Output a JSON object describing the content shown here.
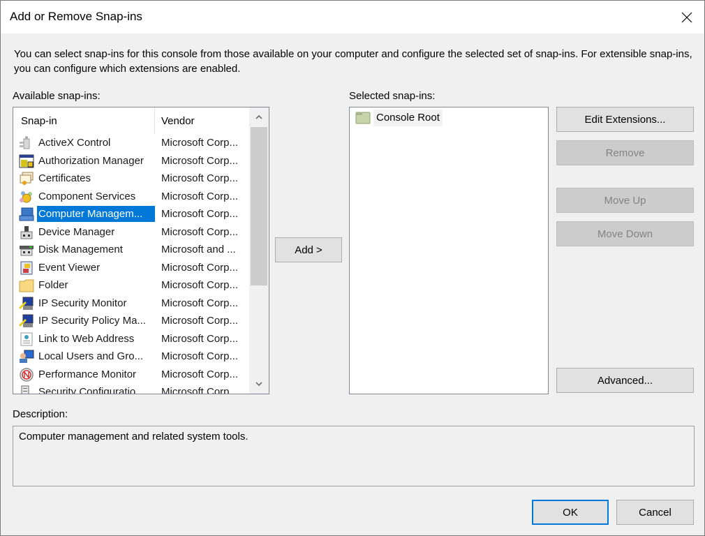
{
  "window": {
    "title": "Add or Remove Snap-ins",
    "close_icon": "close-icon"
  },
  "intro_text": "You can select snap-ins for this console from those available on your computer and configure the selected set of snap-ins. For extensible snap-ins, you can configure which extensions are enabled.",
  "available": {
    "label": "Available snap-ins:",
    "columns": [
      "Snap-in",
      "Vendor"
    ],
    "rows": [
      {
        "name": "ActiveX Control",
        "vendor": "Microsoft Corp...",
        "icon": "activex-icon"
      },
      {
        "name": "Authorization Manager",
        "vendor": "Microsoft Corp...",
        "icon": "authorization-manager-icon"
      },
      {
        "name": "Certificates",
        "vendor": "Microsoft Corp...",
        "icon": "certificates-icon"
      },
      {
        "name": "Component Services",
        "vendor": "Microsoft Corp...",
        "icon": "component-services-icon"
      },
      {
        "name": "Computer Managem...",
        "vendor": "Microsoft Corp...",
        "icon": "computer-management-icon",
        "selected": true
      },
      {
        "name": "Device Manager",
        "vendor": "Microsoft Corp...",
        "icon": "device-manager-icon"
      },
      {
        "name": "Disk Management",
        "vendor": "Microsoft and ...",
        "icon": "disk-management-icon"
      },
      {
        "name": "Event Viewer",
        "vendor": "Microsoft Corp...",
        "icon": "event-viewer-icon"
      },
      {
        "name": "Folder",
        "vendor": "Microsoft Corp...",
        "icon": "folder-icon"
      },
      {
        "name": "IP Security Monitor",
        "vendor": "Microsoft Corp...",
        "icon": "ip-security-monitor-icon"
      },
      {
        "name": "IP Security Policy Ma...",
        "vendor": "Microsoft Corp...",
        "icon": "ip-security-policy-icon"
      },
      {
        "name": "Link to Web Address",
        "vendor": "Microsoft Corp...",
        "icon": "link-web-address-icon"
      },
      {
        "name": "Local Users and Gro...",
        "vendor": "Microsoft Corp...",
        "icon": "local-users-groups-icon"
      },
      {
        "name": "Performance Monitor",
        "vendor": "Microsoft Corp...",
        "icon": "performance-monitor-icon"
      },
      {
        "name": "Security Configuratio...",
        "vendor": "Microsoft Corp...",
        "icon": "security-configuration-icon"
      }
    ],
    "scroll_position": 0.0
  },
  "add_button": "Add >",
  "selected": {
    "label": "Selected snap-ins:",
    "items": [
      {
        "name": "Console Root",
        "icon": "console-root-folder-icon"
      }
    ]
  },
  "side_buttons": {
    "edit_extensions": "Edit Extensions...",
    "remove": "Remove",
    "move_up": "Move Up",
    "move_down": "Move Down",
    "advanced": "Advanced..."
  },
  "description": {
    "label": "Description:",
    "text": "Computer management and related system tools."
  },
  "footer": {
    "ok": "OK",
    "cancel": "Cancel"
  },
  "colors": {
    "selection": "#0078d7",
    "window_bg": "#f0f0f0",
    "disabled_button": "#cccccc"
  }
}
